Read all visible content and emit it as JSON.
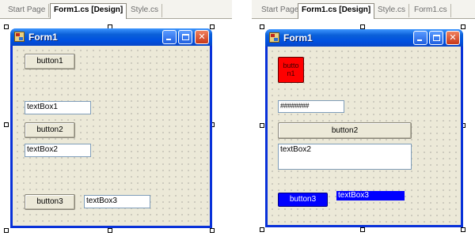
{
  "left": {
    "tabs": [
      "Start Page",
      "Form1.cs [Design]",
      "Style.cs"
    ],
    "active_tab": 1,
    "form_title": "Form1",
    "controls": {
      "button1": "button1",
      "textbox1": "textBox1",
      "button2": "button2",
      "textbox2": "textBox2",
      "button3": "button3",
      "textbox3": "textBox3"
    }
  },
  "right": {
    "tabs": [
      "Start Page",
      "Form1.cs [Design]",
      "Style.cs",
      "Form1.cs"
    ],
    "active_tab": 1,
    "form_title": "Form1",
    "controls": {
      "button1_line1": "butto",
      "button1_line2": "n1",
      "textbox1": "########",
      "button2": "button2",
      "textbox2": "textBox2",
      "button3": "button3",
      "textbox3": "textBox3"
    }
  },
  "colors": {
    "xp_title_blue": "#0a5fd8",
    "form_border": "#0831d9",
    "control_face": "#ece9d8",
    "red_button": "#ff0000",
    "blue_controls": "#0000ff"
  },
  "icons": [
    "form-icon",
    "minimize-icon",
    "maximize-icon",
    "close-icon"
  ]
}
